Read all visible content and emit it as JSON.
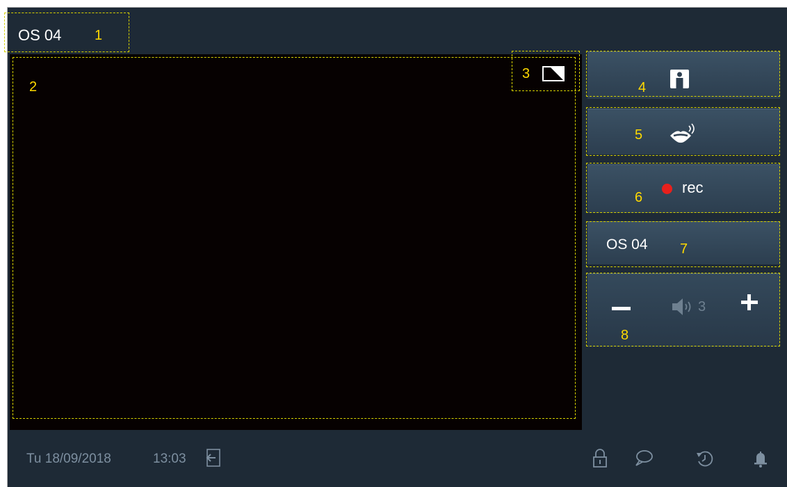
{
  "title": {
    "text": "OS 04",
    "callout": "1"
  },
  "video": {
    "callout": "2"
  },
  "pip": {
    "callout": "3",
    "icon": "picture-in-picture-icon"
  },
  "buttons": {
    "contact": {
      "callout": "4",
      "icon": "person-icon"
    },
    "talk": {
      "callout": "5",
      "icon": "talk-lips-icon"
    },
    "record": {
      "callout": "6",
      "label": "rec",
      "icon": "record-dot-icon",
      "dot_color": "#e8201c"
    },
    "station": {
      "callout": "7",
      "label": "OS 04"
    },
    "volume": {
      "callout": "8",
      "value": "3",
      "icon": "speaker-icon"
    }
  },
  "status_bar": {
    "date": "Tu 18/09/2018",
    "time": "13:03",
    "icons": [
      "return-icon",
      "lock-icon",
      "message-icon",
      "history-icon",
      "bell-icon"
    ]
  },
  "colors": {
    "background": "#1e2a36",
    "video": "#060101",
    "callout": "#ffd900",
    "status_text": "#7d8fa0"
  }
}
